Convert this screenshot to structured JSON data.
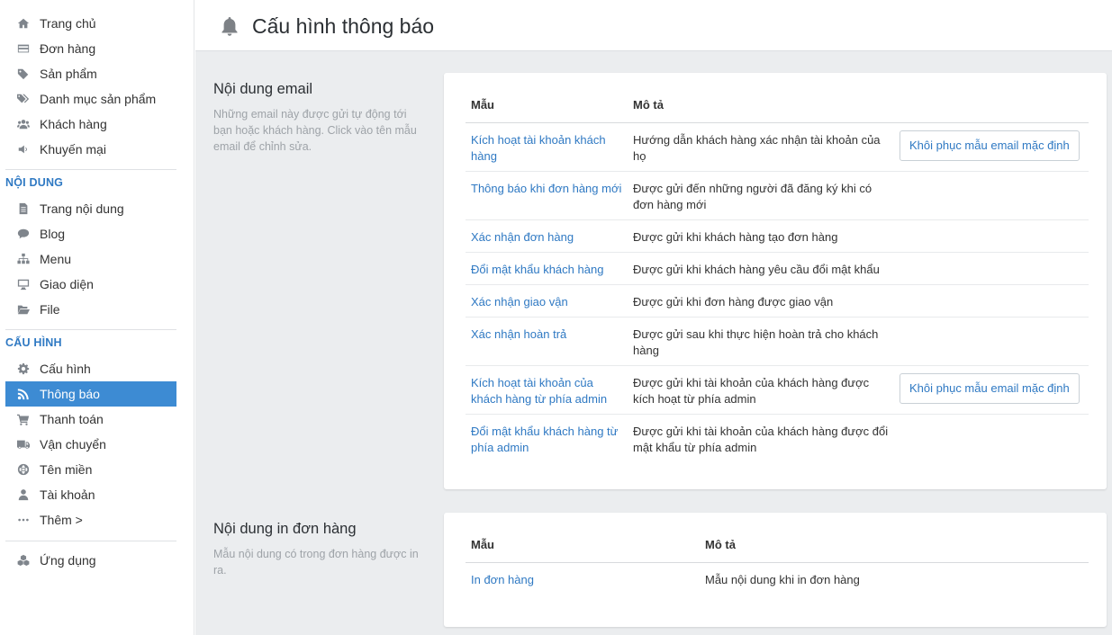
{
  "sidebar": {
    "main_items": [
      {
        "label": "Trang chủ",
        "icon": "home-icon"
      },
      {
        "label": "Đơn hàng",
        "icon": "credit-card-icon"
      },
      {
        "label": "Sản phẩm",
        "icon": "tag-icon"
      },
      {
        "label": "Danh mục sản phẩm",
        "icon": "tags-icon"
      },
      {
        "label": "Khách hàng",
        "icon": "users-icon"
      },
      {
        "label": "Khuyến mại",
        "icon": "volume-icon"
      }
    ],
    "content_heading": "NỘI DUNG",
    "content_items": [
      {
        "label": "Trang nội dung",
        "icon": "file-text-icon"
      },
      {
        "label": "Blog",
        "icon": "comment-icon"
      },
      {
        "label": "Menu",
        "icon": "sitemap-icon"
      },
      {
        "label": "Giao diện",
        "icon": "desktop-icon"
      },
      {
        "label": "File",
        "icon": "folder-open-icon"
      }
    ],
    "config_heading": "CẤU HÌNH",
    "config_items": [
      {
        "label": "Cấu hình",
        "icon": "gear-icon"
      },
      {
        "label": "Thông báo",
        "icon": "rss-icon",
        "active": true
      },
      {
        "label": "Thanh toán",
        "icon": "cart-icon"
      },
      {
        "label": "Vận chuyển",
        "icon": "truck-icon"
      },
      {
        "label": "Tên miền",
        "icon": "globe-icon"
      },
      {
        "label": "Tài khoản",
        "icon": "user-icon"
      },
      {
        "label": "Thêm >",
        "icon": "ellipsis-icon"
      }
    ],
    "apps_item": {
      "label": "Ứng dụng",
      "icon": "cubes-icon"
    }
  },
  "header": {
    "title": "Cấu hình thông báo",
    "icon": "bell-icon"
  },
  "email_section": {
    "title": "Nội dung email",
    "description": "Những email này được gửi tự động tới bạn hoặc khách hàng. Click vào tên mẫu email để chỉnh sửa.",
    "col_template": "Mẫu",
    "col_description": "Mô tả",
    "rows": [
      {
        "template": "Kích hoạt tài khoản khách hàng",
        "description": "Hướng dẫn khách hàng xác nhận tài khoản của họ",
        "action": "Khôi phục mẫu email mặc định"
      },
      {
        "template": "Thông báo khi đơn hàng mới",
        "description": "Được gửi đến những người đã đăng ký khi có đơn hàng mới",
        "action": ""
      },
      {
        "template": "Xác nhận đơn hàng",
        "description": "Được gửi khi khách hàng tạo đơn hàng",
        "action": ""
      },
      {
        "template": "Đổi mật khẩu khách hàng",
        "description": "Được gửi khi khách hàng yêu cầu đổi mật khẩu",
        "action": ""
      },
      {
        "template": "Xác nhận giao vận",
        "description": "Được gửi khi đơn hàng được giao vận",
        "action": ""
      },
      {
        "template": "Xác nhận hoàn trả",
        "description": "Được gửi sau khi thực hiện hoàn trả cho khách hàng",
        "action": ""
      },
      {
        "template": "Kích hoạt tài khoản của khách hàng từ phía admin",
        "description": "Được gửi khi tài khoản của khách hàng được kích hoạt từ phía admin",
        "action": "Khôi phục mẫu email mặc định"
      },
      {
        "template": "Đổi mật khẩu khách hàng từ phía admin",
        "description": "Được gửi khi tài khoản của khách hàng được đổi mật khẩu từ phía admin",
        "action": ""
      }
    ]
  },
  "print_section": {
    "title": "Nội dung in đơn hàng",
    "description": "Mẫu nội dung có trong đơn hàng được in ra.",
    "col_template": "Mẫu",
    "col_description": "Mô tả",
    "rows": [
      {
        "template": "In đơn hàng",
        "description": "Mẫu nội dung khi in đơn hàng"
      }
    ]
  }
}
